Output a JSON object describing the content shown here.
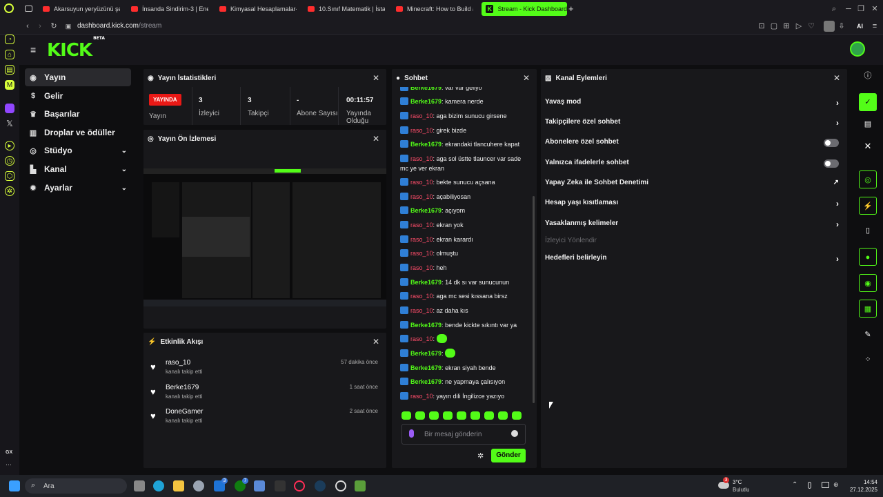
{
  "browser": {
    "tabs": [
      {
        "label": "Akarsuyun yeryüzünü şek"
      },
      {
        "label": "İnsanda Sindirim-3 | Enerj"
      },
      {
        "label": "Kimyasal Hesaplamalar-1"
      },
      {
        "label": "10.Sınıf Matematik | İstatis"
      },
      {
        "label": "Minecraft: How to Build a"
      },
      {
        "label": "Stream - Kick Dashboard"
      }
    ],
    "new_tab": "+",
    "url_host": "dashboard.kick.com",
    "url_path": "/stream",
    "gx_label": "GX",
    "ai_label": "AI"
  },
  "kick": {
    "logo": "KICK",
    "logo_badge": "BETA"
  },
  "nav": {
    "items": [
      {
        "label": "Yayın",
        "icon": "broadcast-icon"
      },
      {
        "label": "Gelir",
        "icon": "dollar-icon"
      },
      {
        "label": "Başarılar",
        "icon": "trophy-icon"
      },
      {
        "label": "Droplar ve ödüller",
        "icon": "gift-icon"
      },
      {
        "label": "Stüdyo",
        "icon": "studio-icon"
      },
      {
        "label": "Kanal",
        "icon": "channel-icon"
      },
      {
        "label": "Ayarlar",
        "icon": "gear-icon"
      }
    ]
  },
  "stats": {
    "title": "Yayın İstatistikleri",
    "live_badge": "YAYINDA",
    "items": [
      {
        "value": "",
        "label": "Yayın"
      },
      {
        "value": "3",
        "label": "İzleyici"
      },
      {
        "value": "3",
        "label": "Takipçi"
      },
      {
        "value": "-",
        "label": "Abone Sayısı"
      },
      {
        "value": "00:11:57",
        "label": "Yayında Olduğu"
      }
    ]
  },
  "preview": {
    "title": "Yayın Ön İzlemesi"
  },
  "activity": {
    "title": "Etkinlik Akışı",
    "items": [
      {
        "name": "raso_10",
        "action": "kanalı takip etti",
        "time": "57 dakika önce"
      },
      {
        "name": "Berke1679",
        "action": "kanalı takip etti",
        "time": "1 saat önce"
      },
      {
        "name": "DoneGamer",
        "action": "kanalı takip etti",
        "time": "2 saat önce"
      }
    ]
  },
  "chat": {
    "title": "Sohbet",
    "messages": [
      {
        "user": "Berke1679",
        "text": "var var geliyo"
      },
      {
        "user": "Berke1679",
        "text": "kamera nerde"
      },
      {
        "user": "raso_10",
        "text": "aga bizim sunucu girsene"
      },
      {
        "user": "raso_10",
        "text": "girek bizde"
      },
      {
        "user": "Berke1679",
        "text": "ekrandaki tlancuhere kapat"
      },
      {
        "user": "raso_10",
        "text": "aga sol üstte tlauncer var sade mc ye ver ekran"
      },
      {
        "user": "raso_10",
        "text": "bekte sunucu açsana"
      },
      {
        "user": "raso_10",
        "text": "açabiliyosan"
      },
      {
        "user": "Berke1679",
        "text": "açıyom"
      },
      {
        "user": "raso_10",
        "text": "ekran yok"
      },
      {
        "user": "raso_10",
        "text": "ekran karardı"
      },
      {
        "user": "raso_10",
        "text": "olmuştu"
      },
      {
        "user": "raso_10",
        "text": "heh"
      },
      {
        "user": "Berke1679",
        "text": "14 dk sı var sunucunun"
      },
      {
        "user": "raso_10",
        "text": "aga mc sesi kıssana birsz"
      },
      {
        "user": "raso_10",
        "text": "az daha kıs"
      },
      {
        "user": "Berke1679",
        "text": "bende kickte sıkıntı var ya"
      },
      {
        "user": "raso_10",
        "text": ""
      },
      {
        "user": "Berke1679",
        "text": ""
      },
      {
        "user": "Berke1679",
        "text": "ekran siyah bende"
      },
      {
        "user": "Berke1679",
        "text": "ne yapmaya çalısıyon"
      },
      {
        "user": "raso_10",
        "text": "yayın dili İngilizce yazıyo"
      }
    ],
    "input_placeholder": "Bir mesaj gönderin",
    "send_label": "Gönder"
  },
  "channel_actions": {
    "title": "Kanal Eylemleri",
    "items": [
      {
        "label": "Yavaş mod",
        "control": "chevron"
      },
      {
        "label": "Takipçilere özel sohbet",
        "control": "chevron"
      },
      {
        "label": "Abonelere özel sohbet",
        "control": "toggle-off"
      },
      {
        "label": "Yalnızca ifadelerle sohbet",
        "control": "toggle-off"
      },
      {
        "label": "Yapay Zeka ile Sohbet Denetimi",
        "control": "external"
      },
      {
        "label": "Hesap yaşı kısıtlaması",
        "control": "chevron"
      },
      {
        "label": "Yasaklanmış kelimeler",
        "control": "chevron"
      },
      {
        "label": "İzleyici Yönlendir",
        "control": "disabled"
      },
      {
        "label": "Hedefleri belirleyin",
        "control": "chevron"
      }
    ]
  },
  "taskbar": {
    "search": "Ara",
    "badge_1": "3",
    "badge_2": "7",
    "weather_badge": "3",
    "weather_temp": "3°C",
    "weather_desc": "Bulutlu",
    "time": "14:54",
    "date": "27.12.2025"
  }
}
